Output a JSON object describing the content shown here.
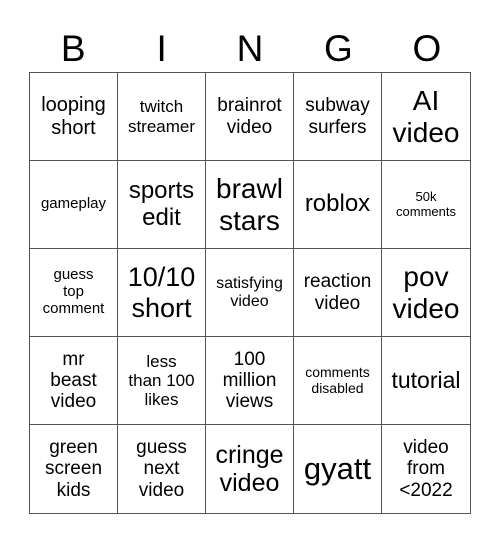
{
  "title_letters": [
    "B",
    "I",
    "N",
    "G",
    "O"
  ],
  "cells": [
    {
      "text": "looping\nshort",
      "size": "20px"
    },
    {
      "text": "twitch\nstreamer",
      "size": "17px"
    },
    {
      "text": "brainrot\nvideo",
      "size": "19px"
    },
    {
      "text": "subway\nsurfers",
      "size": "19px"
    },
    {
      "text": "AI\nvideo",
      "size": "28px"
    },
    {
      "text": "gameplay",
      "size": "15px"
    },
    {
      "text": "sports\nedit",
      "size": "24px"
    },
    {
      "text": "brawl\nstars",
      "size": "28px"
    },
    {
      "text": "roblox",
      "size": "24px"
    },
    {
      "text": "50k\ncomments",
      "size": "13px"
    },
    {
      "text": "guess\ntop\ncomment",
      "size": "15px"
    },
    {
      "text": "10/10\nshort",
      "size": "27px"
    },
    {
      "text": "satisfying\nvideo",
      "size": "16px"
    },
    {
      "text": "reaction\nvideo",
      "size": "19px"
    },
    {
      "text": "pov\nvideo",
      "size": "28px"
    },
    {
      "text": "mr\nbeast\nvideo",
      "size": "19px"
    },
    {
      "text": "less\nthan 100\nlikes",
      "size": "17px"
    },
    {
      "text": "100\nmillion\nviews",
      "size": "19px"
    },
    {
      "text": "comments\ndisabled",
      "size": "14px"
    },
    {
      "text": "tutorial",
      "size": "23px"
    },
    {
      "text": "green\nscreen\nkids",
      "size": "19px"
    },
    {
      "text": "guess\nnext\nvideo",
      "size": "19px"
    },
    {
      "text": "cringe\nvideo",
      "size": "25px"
    },
    {
      "text": "gyatt",
      "size": "31px"
    },
    {
      "text": "video\nfrom\n<2022",
      "size": "19px"
    }
  ]
}
